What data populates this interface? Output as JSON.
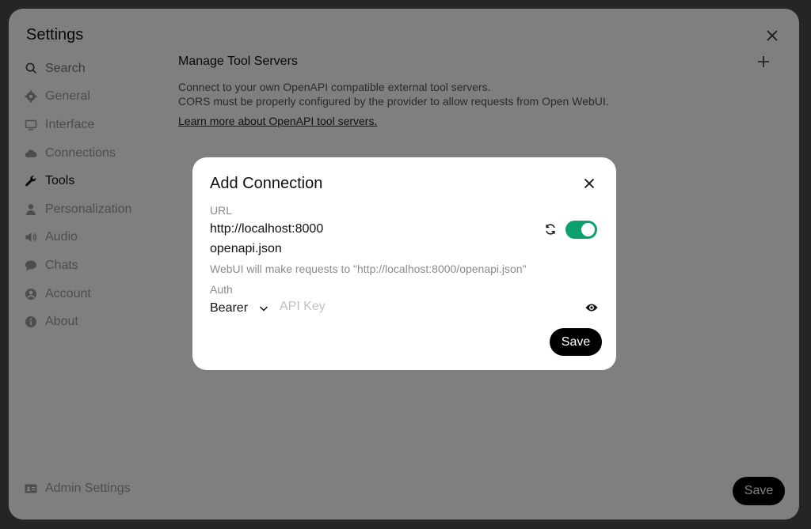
{
  "settings": {
    "title": "Settings",
    "sidebar": {
      "search_placeholder": "Search",
      "items": [
        {
          "label": "General",
          "icon": "gear-icon"
        },
        {
          "label": "Interface",
          "icon": "monitor-icon"
        },
        {
          "label": "Connections",
          "icon": "cloud-icon"
        },
        {
          "label": "Tools",
          "icon": "wrench-icon",
          "active": true
        },
        {
          "label": "Personalization",
          "icon": "user-icon"
        },
        {
          "label": "Audio",
          "icon": "speaker-icon"
        },
        {
          "label": "Chats",
          "icon": "chat-icon"
        },
        {
          "label": "Account",
          "icon": "account-icon"
        },
        {
          "label": "About",
          "icon": "info-icon"
        }
      ],
      "admin_label": "Admin Settings"
    },
    "main": {
      "title": "Manage Tool Servers",
      "desc_line1": "Connect to your own OpenAPI compatible external tool servers.",
      "desc_line2": "CORS must be properly configured by the provider to allow requests from Open WebUI.",
      "learn_more": "Learn more about OpenAPI tool servers."
    },
    "save_label": "Save"
  },
  "modal": {
    "title": "Add Connection",
    "url_label": "URL",
    "url_value": "http://localhost:8000",
    "path_value": "openapi.json",
    "hint": "WebUI will make requests to \"http://localhost:8000/openapi.json\"",
    "auth_label": "Auth",
    "auth_type": "Bearer",
    "api_key_placeholder": "API Key",
    "enabled": true,
    "save_label": "Save"
  },
  "colors": {
    "toggle_on": "#0e9f6e",
    "primary_button": "#000000"
  }
}
